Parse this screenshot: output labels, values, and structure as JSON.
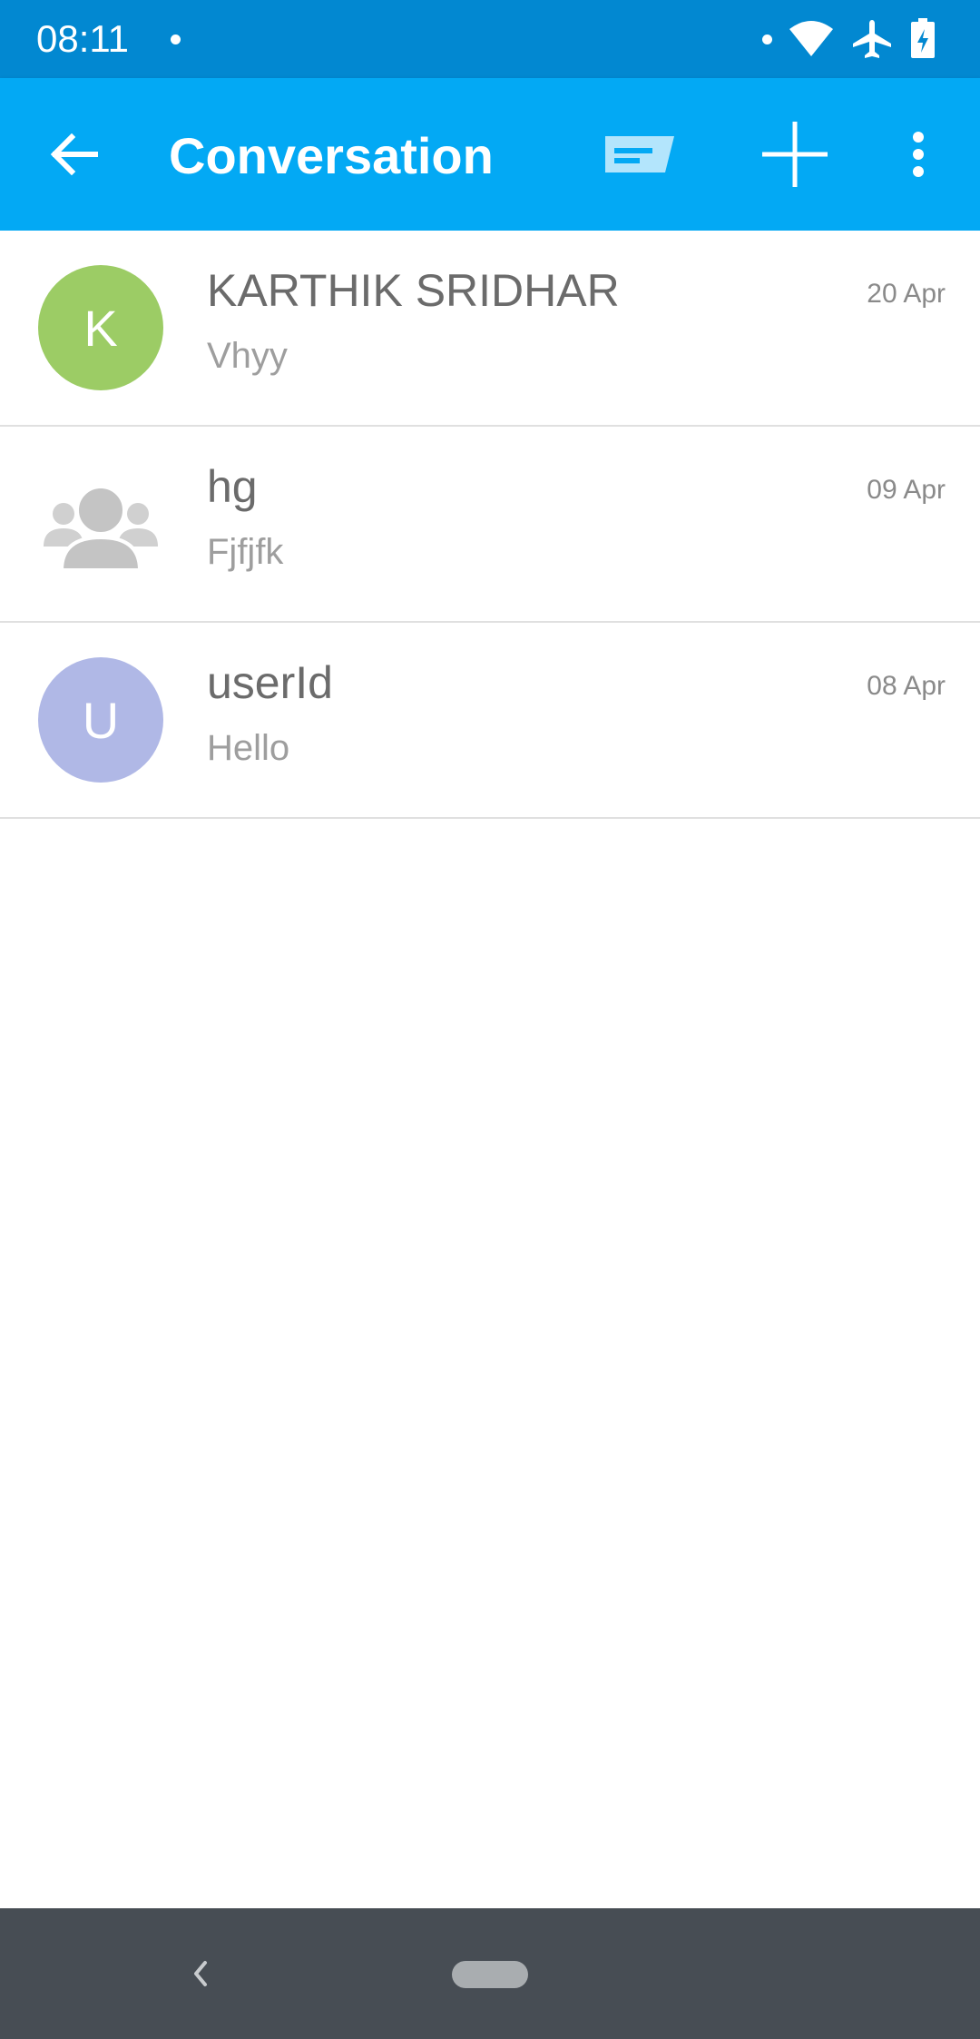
{
  "status_bar": {
    "time": "08:11",
    "icons": [
      "notification-dot-icon",
      "wifi-icon",
      "airplane-mode-icon",
      "battery-charging-icon"
    ]
  },
  "app_bar": {
    "title": "Conversation",
    "icons": [
      "back-arrow-icon",
      "message-icon",
      "plus-icon",
      "more-vert-icon"
    ]
  },
  "conversations": [
    {
      "name": "KARTHIK SRIDHAR",
      "message": "Vhyy",
      "date": "20 Apr",
      "avatar_letter": "K",
      "avatar_color": "#9ccc65"
    },
    {
      "name": "hg",
      "message": "Fjfjfk",
      "date": "09 Apr",
      "avatar_letter": "",
      "avatar_icon": "group-icon"
    },
    {
      "name": "userId",
      "message": "Hello",
      "date": "08 Apr",
      "avatar_letter": "U",
      "avatar_color": "#b0b8e6"
    }
  ],
  "colors": {
    "status_bar": "#0288d1",
    "app_bar": "#03a9f4",
    "nav_bar": "#474d54"
  },
  "nav_bar": {
    "icons": [
      "nav-back-icon",
      "nav-home-pill-icon"
    ]
  }
}
